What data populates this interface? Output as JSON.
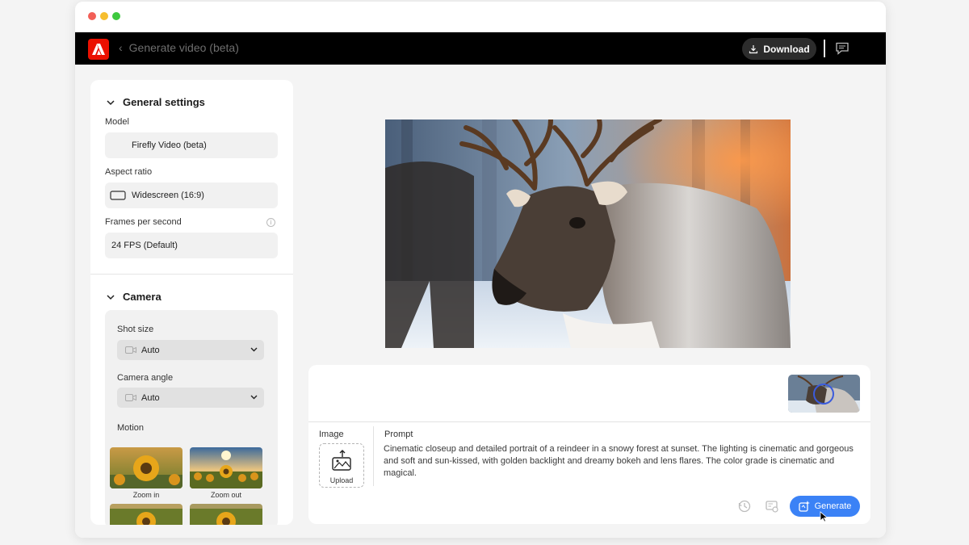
{
  "window": {
    "traffic_lights": [
      "close",
      "minimize",
      "maximize"
    ]
  },
  "appbar": {
    "logo_icon": "adobe-logo-icon",
    "back_label": "Generate video (beta)",
    "download_label": "Download",
    "brand_color": "#eb1000"
  },
  "sidebar": {
    "general": {
      "title": "General settings",
      "model_label": "Model",
      "model_value": "Firefly Video (beta)",
      "aspect_label": "Aspect ratio",
      "aspect_value": "Widescreen (16:9)",
      "fps_label": "Frames per second",
      "fps_value": "24 FPS (Default)"
    },
    "camera": {
      "title": "Camera",
      "shot_label": "Shot size",
      "shot_value": "Auto",
      "angle_label": "Camera angle",
      "angle_value": "Auto",
      "motion_label": "Motion",
      "motion_items": [
        "Zoom in",
        "Zoom out"
      ]
    }
  },
  "panel": {
    "image_label": "Image",
    "upload_label": "Upload",
    "prompt_label": "Prompt",
    "prompt_text": "Cinematic closeup and detailed portrait of a reindeer in a snowy forest at sunset. The lighting is cinematic and gorgeous and soft and sun-kissed, with golden backlight and dreamy bokeh and lens flares. The color grade is cinematic and magical.",
    "generate_label": "Generate",
    "accent_color": "#3b82f6"
  }
}
